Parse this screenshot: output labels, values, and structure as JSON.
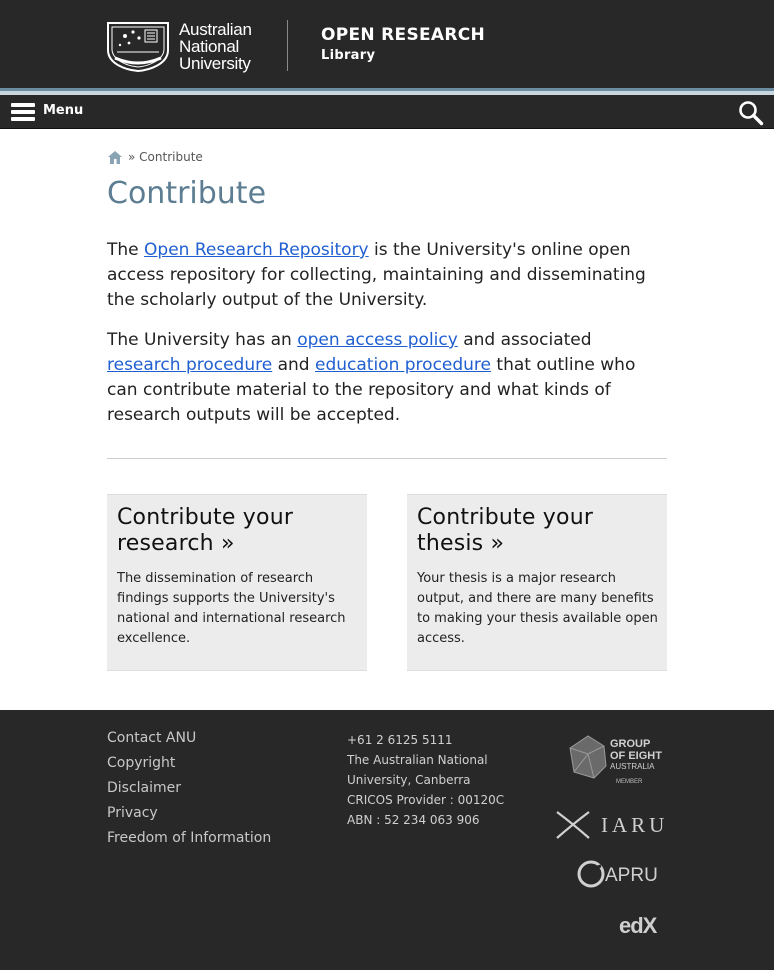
{
  "header": {
    "university_line1": "Australian",
    "university_line2": "National",
    "university_line3": "University",
    "site_title": "OPEN RESEARCH",
    "site_subtitle": "Library"
  },
  "menu": {
    "label": "Menu",
    "search_icon": "search-icon",
    "menu_icon": "hamburger-menu-icon"
  },
  "breadcrumb": {
    "home_icon": "home-icon",
    "separator": "»",
    "current": "Contribute"
  },
  "page": {
    "title": "Contribute",
    "p1": {
      "before": "The ",
      "link": "Open Research Repository",
      "after": " is the University's online open access repository for collecting, maintaining and disseminating the scholarly output of the University."
    },
    "p2": {
      "t1": "The University has an ",
      "link1": "open access policy",
      "t2": " and associated ",
      "link2": "research procedure",
      "t3": " and ",
      "link3": "education procedure",
      "t4": " that outline who can contribute material to the repository and what kinds of research outputs will be accepted."
    }
  },
  "cards": [
    {
      "title": "Contribute your research »",
      "text": "The dissemination of research findings supports the University's national and international research excellence."
    },
    {
      "title": "Contribute your thesis »",
      "text": "Your thesis is a major research output, and there are many benefits to making your thesis available open access."
    }
  ],
  "footer": {
    "links": [
      "Contact ANU",
      "Copyright",
      "Disclaimer",
      "Privacy",
      "Freedom of Information"
    ],
    "contact": {
      "phone": "+61 2 6125 5111",
      "name": "The Australian National University, Canberra",
      "cricos": "CRICOS Provider : 00120C",
      "abn": "ABN : 52 234 063 906"
    },
    "partners": {
      "go8_line1": "GROUP",
      "go8_line2": "OF EIGHT",
      "go8_line3": "AUSTRALIA",
      "go8_line4": "MEMBER",
      "iaru": "IARU",
      "apru": "APRU",
      "edx": "edX"
    }
  }
}
